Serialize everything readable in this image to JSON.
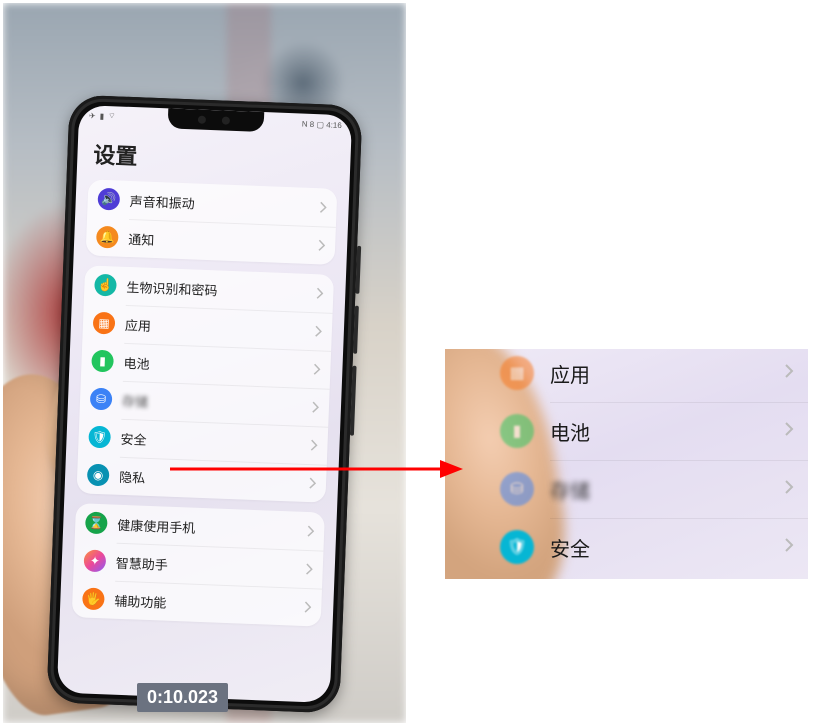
{
  "page_title": "设置",
  "status_left_icons": [
    "airplane-icon",
    "signal-icon",
    "wifi-icon"
  ],
  "status_right": "N 8  ▢ 4:16",
  "groups": [
    {
      "rows": [
        {
          "id": "sound",
          "icon": "ic-sound",
          "glyph": "🔊",
          "label": "声音和振动"
        },
        {
          "id": "notify",
          "icon": "ic-notif",
          "glyph": "🔔",
          "label": "通知"
        }
      ]
    },
    {
      "rows": [
        {
          "id": "biometric",
          "icon": "ic-bio",
          "glyph": "☝",
          "label": "生物识别和密码"
        },
        {
          "id": "apps",
          "icon": "ic-apps",
          "glyph": "▦",
          "label": "应用"
        },
        {
          "id": "battery",
          "icon": "ic-batt",
          "glyph": "▮",
          "label": "电池"
        },
        {
          "id": "storage",
          "icon": "ic-stor",
          "glyph": "⛁",
          "label": "存储",
          "blurred": true
        },
        {
          "id": "security",
          "icon": "ic-sec",
          "glyph": "🛡",
          "label": "安全"
        },
        {
          "id": "privacy",
          "icon": "ic-priv",
          "glyph": "◉",
          "label": "隐私"
        }
      ]
    },
    {
      "rows": [
        {
          "id": "health",
          "icon": "ic-health",
          "glyph": "⌛",
          "label": "健康使用手机"
        },
        {
          "id": "assist",
          "icon": "ic-assist",
          "glyph": "✦",
          "label": "智慧助手"
        },
        {
          "id": "access",
          "icon": "ic-access",
          "glyph": "🖐",
          "label": "辅助功能"
        }
      ]
    }
  ],
  "timestamp": "0:10.023",
  "zoom_rows": [
    {
      "id": "apps",
      "icon": "ic-apps",
      "glyph": "▦",
      "label": "应用",
      "obscured": true
    },
    {
      "id": "battery",
      "icon": "ic-batt",
      "glyph": "▮",
      "label": "电池",
      "obscured": true
    },
    {
      "id": "storage",
      "icon": "ic-stor",
      "glyph": "⛁",
      "label": "存储",
      "blurred": true,
      "obscured": true
    },
    {
      "id": "security",
      "icon": "ic-sec",
      "glyph": "🛡",
      "label": "安全"
    }
  ]
}
